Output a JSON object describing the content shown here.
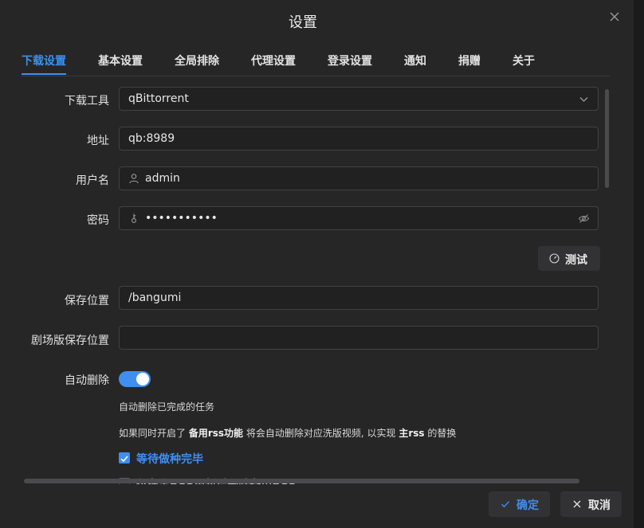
{
  "dialog": {
    "title": "设置"
  },
  "tabs": [
    {
      "label": "下载设置",
      "active": true
    },
    {
      "label": "基本设置",
      "active": false
    },
    {
      "label": "全局排除",
      "active": false
    },
    {
      "label": "代理设置",
      "active": false
    },
    {
      "label": "登录设置",
      "active": false
    },
    {
      "label": "通知",
      "active": false
    },
    {
      "label": "捐赠",
      "active": false
    },
    {
      "label": "关于",
      "active": false
    }
  ],
  "form": {
    "downloader": {
      "label": "下载工具",
      "value": "qBittorrent",
      "icon": "chevron-down-icon"
    },
    "host": {
      "label": "地址",
      "value": "qb:8989"
    },
    "username": {
      "label": "用户名",
      "value": "admin",
      "icon": "user-icon"
    },
    "password": {
      "label": "密码",
      "value": "•••••••••••",
      "icon": "key-icon",
      "suffix_icon": "eye-off-icon"
    },
    "test_button": {
      "label": "测试",
      "icon": "gauge-icon"
    },
    "save_path": {
      "label": "保存位置",
      "value": "/bangumi"
    },
    "movie_path": {
      "label": "剧场版保存位置",
      "value": ""
    },
    "auto_delete": {
      "label": "自动删除",
      "enabled": true,
      "description": "自动删除已完成的任务",
      "note_prefix": "如果同时开启了 ",
      "note_bold1": "备用rss功能",
      "note_middle": " 将会自动删除对应洗版视频, 以实现 ",
      "note_bold2": "主rss",
      "note_suffix": " 的替换"
    },
    "wait_seeding": {
      "label": "等待做种完毕",
      "checked": true
    },
    "delete_backup_rss": {
      "label": "仅在主RSS更新后删除备用RSS",
      "checked": false
    }
  },
  "footer": {
    "ok_label": "确定",
    "cancel_label": "取消"
  },
  "colors": {
    "accent": "#3f8ff0",
    "background": "#262627",
    "input_border": "#424245"
  }
}
